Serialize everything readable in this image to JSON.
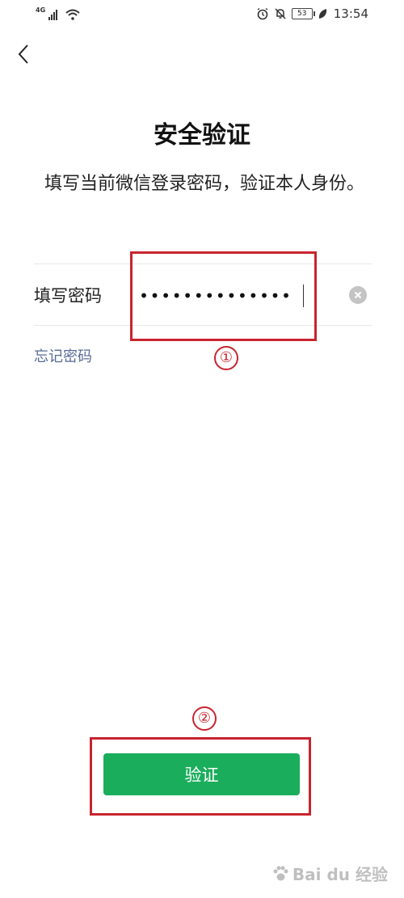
{
  "status_bar": {
    "network": "4G",
    "battery": "53",
    "time": "13:54"
  },
  "header": {
    "title": "安全验证",
    "subtitle": "填写当前微信登录密码，验证本人身份。"
  },
  "form": {
    "password_label": "填写密码",
    "password_value": "••••••••••••••",
    "forgot_password": "忘记密码"
  },
  "annotations": {
    "step1": "①",
    "step2": "②"
  },
  "actions": {
    "verify_label": "验证"
  },
  "watermark": {
    "text": "Bai du 经验"
  },
  "colors": {
    "primary_green": "#1aad5b",
    "link_blue": "#576b95",
    "annotation_red": "#c8242e"
  }
}
